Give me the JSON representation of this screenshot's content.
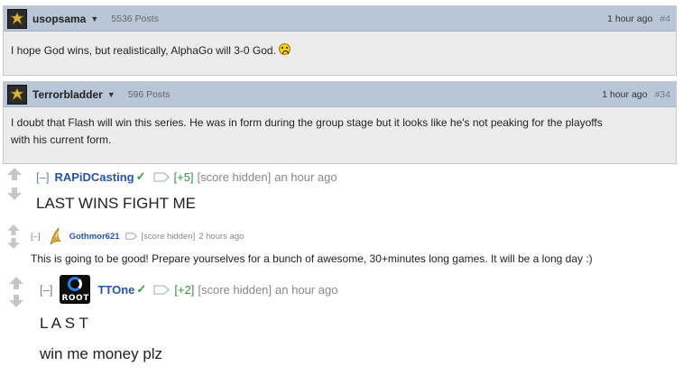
{
  "posts": [
    {
      "author": "usopsama",
      "post_count": "5536 Posts",
      "time": "1 hour ago",
      "number": "#4",
      "body": "I hope God wins, but realistically, AlphaGo will 3-0 God.",
      "emoji": "frown-emoji"
    },
    {
      "author": "Terrorbladder",
      "post_count": "596 Posts",
      "time": "1 hour ago",
      "number": "#34",
      "body_line1": "I doubt that Flash will win this series. He was in form during the group stage but it looks like he's not peaking for the playoffs",
      "body_line2": "with his current form."
    }
  ],
  "comments": [
    {
      "collapse": "[–]",
      "author": "RAPiDCasting",
      "verified": "✓",
      "score": "[+5]",
      "hidden": "[score hidden]",
      "time": "an hour ago",
      "text": "LAST WINS FIGHT ME"
    },
    {
      "collapse": "[–]",
      "author": "Gothmor621",
      "hidden": "[score hidden]",
      "time": "2 hours ago",
      "text": "This is going to be good! Prepare yourselves for a bunch of awesome, 30+minutes long games. It will be a long day :)"
    },
    {
      "collapse": "[–]",
      "author": "TTOne",
      "verified": "✓",
      "score": "[+2]",
      "hidden": "[score hidden]",
      "time": "an hour ago",
      "flair_logo_text": "ROOT",
      "text_line1": "L A S T",
      "text_line2": "win me money plz"
    }
  ],
  "icons": {
    "post_avatar": "guild-emblem-icon",
    "vote_up": "upvote-arrow-icon",
    "vote_down": "downvote-arrow-icon",
    "flair": "flair-tag-icon",
    "gothmor_flair": "protoss-flair-icon",
    "ttone_flair": "root-gaming-logo-icon"
  },
  "colors": {
    "post_header": "#b8c6d8",
    "post_body": "#ececec",
    "author_link": "#2a53a8",
    "score_green": "#3b8d3b",
    "verified_green": "#3b9a3b"
  }
}
